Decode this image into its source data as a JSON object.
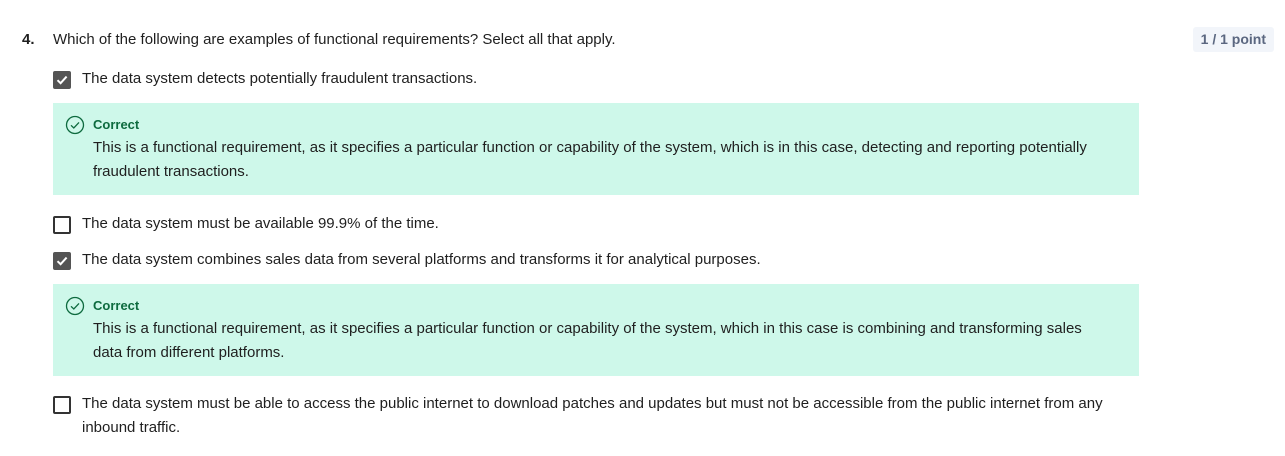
{
  "question": {
    "number": "4.",
    "text": "Which of the following are examples of functional requirements? Select all that apply.",
    "score": "1 / 1 point"
  },
  "options": [
    {
      "label": "The data system detects potentially fraudulent transactions.",
      "checked": true
    },
    {
      "label": "The data system must be available 99.9% of the time.",
      "checked": false
    },
    {
      "label": "The data system combines sales data from several platforms and transforms it for analytical purposes.",
      "checked": true
    },
    {
      "label": "The data system must be able to access the public internet to download patches and updates but must not be accessible from the public internet from any inbound traffic.",
      "checked": false
    }
  ],
  "feedback": [
    {
      "title": "Correct",
      "text": "This is a functional requirement, as it specifies a particular function or capability of the system, which is in this case, detecting and reporting potentially fraudulent transactions."
    },
    {
      "title": "Correct",
      "text": "This is a functional requirement, as it specifies a particular function or capability of the system, which in this case is combining and transforming sales data from different platforms."
    }
  ],
  "colors": {
    "feedback_bg": "#cef8ea",
    "correct_green": "#0e6b3f",
    "checkbox_checked": "#545454",
    "score_bg": "#f2f5fa"
  },
  "icons": {
    "checkbox_check": "check-icon",
    "correct_status": "check-circle-icon"
  }
}
